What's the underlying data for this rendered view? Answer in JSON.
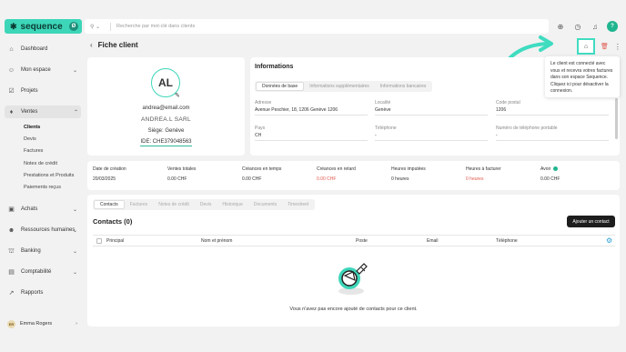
{
  "app": {
    "logo": "sequence",
    "logo_badge": "Ø"
  },
  "nav": {
    "dashboard": "Dashboard",
    "mon_espace": "Mon espace",
    "projets": "Projets",
    "ventes": "Ventes",
    "sub": [
      "Clients",
      "Devis",
      "Factures",
      "Notes de crédit",
      "Prestations et Produits",
      "Paiements reçus"
    ],
    "achats": "Achats",
    "rh": "Ressources humaines",
    "banking": "Banking",
    "compta": "Comptabilité",
    "rapports": "Rapports"
  },
  "user": {
    "initials": "ER",
    "name": "Emma Rogers"
  },
  "search": {
    "placeholder": "Recherche par mot-clé dans clients"
  },
  "page": {
    "title": "Fiche client"
  },
  "profile": {
    "initials": "AL",
    "email": "andrea@email.com",
    "name": "ANDREA.L SARL",
    "siege": "Siège: Genève",
    "ide": "IDE: CHE379048563"
  },
  "info": {
    "title": "Informations",
    "tabs": [
      "Données de base",
      "Informations supplémentaires",
      "Informations bancaires"
    ],
    "fields": {
      "adresse": {
        "label": "Adresse",
        "value": "Avenue Peschier, 18, 1206  Genève 1206"
      },
      "localite": {
        "label": "Localité",
        "value": "Genève"
      },
      "code_postal": {
        "label": "Code postal",
        "value": "1206"
      },
      "pays": {
        "label": "Pays",
        "value": "CH"
      },
      "telephone": {
        "label": "Téléphone",
        "value": "-"
      },
      "portable": {
        "label": "Numéro de téléphone portable",
        "value": "-"
      }
    }
  },
  "tooltip": {
    "text": "Le client est connecté avec vous et recevra votres factures dans son espace Sequence. Cliquez ici pour désactiver la connexion."
  },
  "stats": [
    {
      "label": "Date de création",
      "value": "20/03/2025"
    },
    {
      "label": "Ventes totales",
      "value": "0.00 CHF"
    },
    {
      "label": "Créances en temps",
      "value": "0.00 CHF"
    },
    {
      "label": "Créances en retard",
      "value": "0.00 CHF"
    },
    {
      "label": "Heures imputées",
      "value": "0 heures"
    },
    {
      "label": "Heures à facturer",
      "value": "0 heures"
    },
    {
      "label": "Avoir",
      "value": "0.00 CHF"
    }
  ],
  "contacts": {
    "tabs": [
      "Contacts",
      "Factures",
      "Notes de crédit",
      "Devis",
      "Historique",
      "Documents",
      "Timesheet"
    ],
    "title": "Contacts (0)",
    "add_label": "Ajouter un contact",
    "columns": [
      "Principal",
      "Nom et prénom",
      "Poste",
      "Email",
      "Téléphone"
    ],
    "empty": "Vous n'avez pas encore ajouté de contacts pour ce client."
  },
  "colors": {
    "accent": "#3dd6b9",
    "danger": "#e05a4f",
    "primary_btn": "#1d1d1d"
  }
}
